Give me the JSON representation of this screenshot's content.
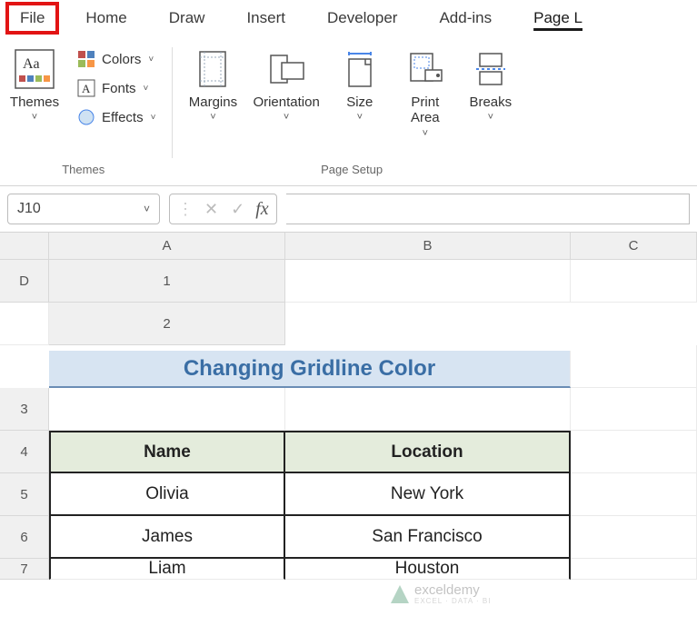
{
  "menu": {
    "file": "File",
    "home": "Home",
    "draw": "Draw",
    "insert": "Insert",
    "developer": "Developer",
    "addins": "Add-ins",
    "page_layout": "Page L"
  },
  "ribbon": {
    "themes": {
      "themes_label": "Themes",
      "colors_label": "Colors",
      "fonts_label": "Fonts",
      "effects_label": "Effects",
      "group_label": "Themes"
    },
    "page_setup": {
      "margins_label": "Margins",
      "orientation_label": "Orientation",
      "size_label": "Size",
      "print_area_label": "Print\nArea",
      "breaks_label": "Breaks",
      "group_label": "Page Setup"
    },
    "chevron": "˅"
  },
  "formula_bar": {
    "cell_ref": "J10",
    "fx_label": "fx",
    "formula_value": ""
  },
  "grid": {
    "col_headers": [
      "A",
      "B",
      "C",
      "D"
    ],
    "row_headers": [
      "1",
      "2",
      "3",
      "4",
      "5",
      "6",
      "7"
    ],
    "title": "Changing Gridline Color",
    "table": {
      "headers": [
        "Name",
        "Location"
      ],
      "rows": [
        [
          "Olivia",
          "New York"
        ],
        [
          "James",
          "San Francisco"
        ],
        [
          "Liam",
          "Houston"
        ]
      ]
    }
  },
  "watermark": {
    "text": "exceldemy",
    "sub": "EXCEL · DATA · BI"
  }
}
